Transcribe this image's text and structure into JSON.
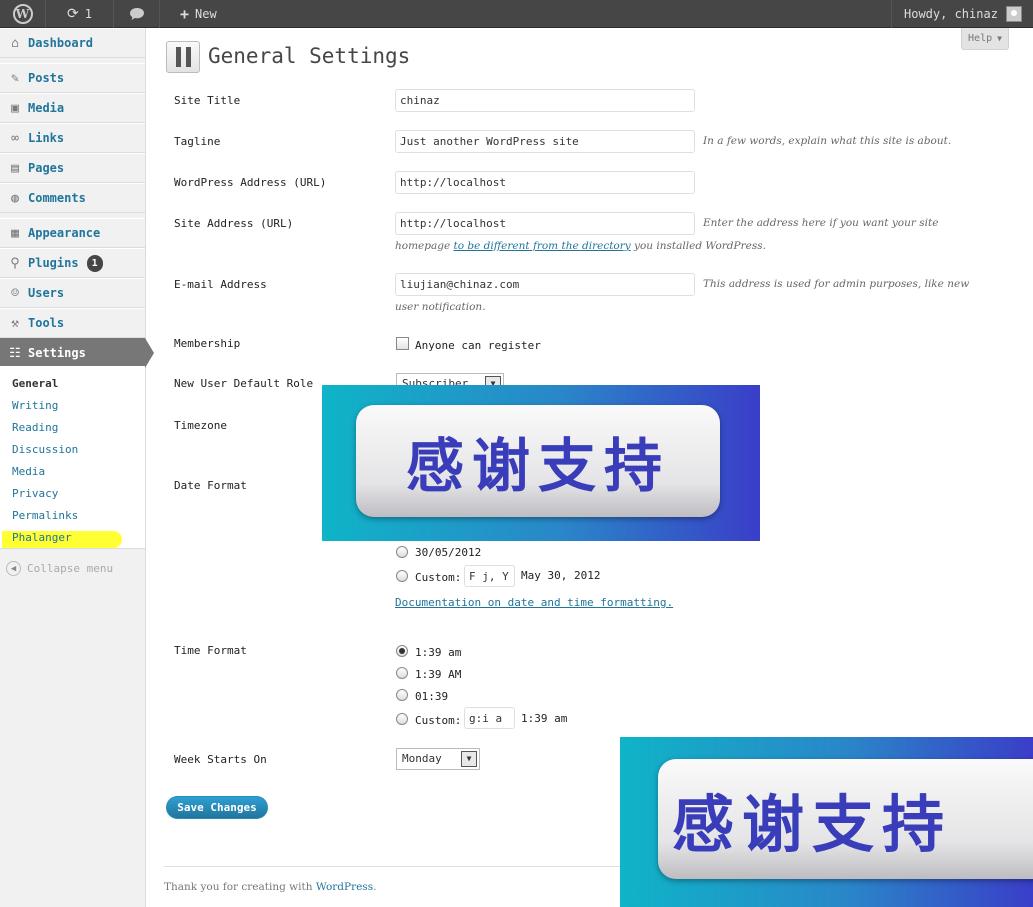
{
  "admin_bar": {
    "wp_logo": "W",
    "updates_count": "1",
    "new_label": "New",
    "greeting": "Howdy, chinaz"
  },
  "sidebar": {
    "items": [
      {
        "label": "Dashboard",
        "icon": "dashboard-icon"
      },
      {
        "label": "Posts",
        "icon": "pin-icon"
      },
      {
        "label": "Media",
        "icon": "media-icon"
      },
      {
        "label": "Links",
        "icon": "link-icon"
      },
      {
        "label": "Pages",
        "icon": "page-icon"
      },
      {
        "label": "Comments",
        "icon": "comment-icon"
      },
      {
        "label": "Appearance",
        "icon": "appearance-icon"
      },
      {
        "label": "Plugins",
        "icon": "plugin-icon",
        "badge": "1"
      },
      {
        "label": "Users",
        "icon": "users-icon"
      },
      {
        "label": "Tools",
        "icon": "tools-icon"
      },
      {
        "label": "Settings",
        "icon": "settings-icon"
      }
    ],
    "submenu": [
      "General",
      "Writing",
      "Reading",
      "Discussion",
      "Media",
      "Privacy",
      "Permalinks",
      "Phalanger"
    ],
    "collapse_label": "Collapse menu"
  },
  "page": {
    "title": "General Settings",
    "help_label": "Help"
  },
  "form": {
    "site_title": {
      "label": "Site Title",
      "value": "chinaz"
    },
    "tagline": {
      "label": "Tagline",
      "value": "Just another WordPress site",
      "desc": "In a few words, explain what this site is about."
    },
    "wp_address": {
      "label": "WordPress Address (URL)",
      "value": "http://localhost"
    },
    "site_address": {
      "label": "Site Address (URL)",
      "value": "http://localhost",
      "desc_1": "Enter the address here if you want your site",
      "desc_2_pre": "homepage",
      "desc_2_link": "to be different from the directory",
      "desc_2_post": "you installed WordPress."
    },
    "email": {
      "label": "E-mail Address",
      "value": "liujian@chinaz.com",
      "desc_1": "This address is used for admin purposes, like new",
      "desc_2": "user notification."
    },
    "membership": {
      "label": "Membership",
      "checkbox_label": "Anyone can register",
      "checked": false
    },
    "default_role": {
      "label": "New User Default Role",
      "value": "Subscriber"
    },
    "timezone": {
      "label": "Timezone"
    },
    "date_format": {
      "label": "Date Format",
      "option_dmy": "30/05/2012",
      "custom_label": "Custom:",
      "custom_value": "F j, Y",
      "custom_preview": "May 30, 2012",
      "doc_link": "Documentation on date and time formatting."
    },
    "time_format": {
      "label": "Time Format",
      "options": [
        "1:39 am",
        "1:39 AM",
        "01:39"
      ],
      "selected_index": 0,
      "custom_label": "Custom:",
      "custom_value": "g:i a",
      "custom_preview": "1:39 am"
    },
    "week_starts": {
      "label": "Week Starts On",
      "value": "Monday"
    },
    "save_label": "Save Changes"
  },
  "footer": {
    "text_pre": "Thank you for creating with",
    "link": "WordPress",
    "text_post": "."
  },
  "overlays": {
    "banner_text": "感谢支持"
  },
  "colors": {
    "accent": "#21759b",
    "admin_bar": "#464646",
    "highlight": "#ffff33"
  }
}
